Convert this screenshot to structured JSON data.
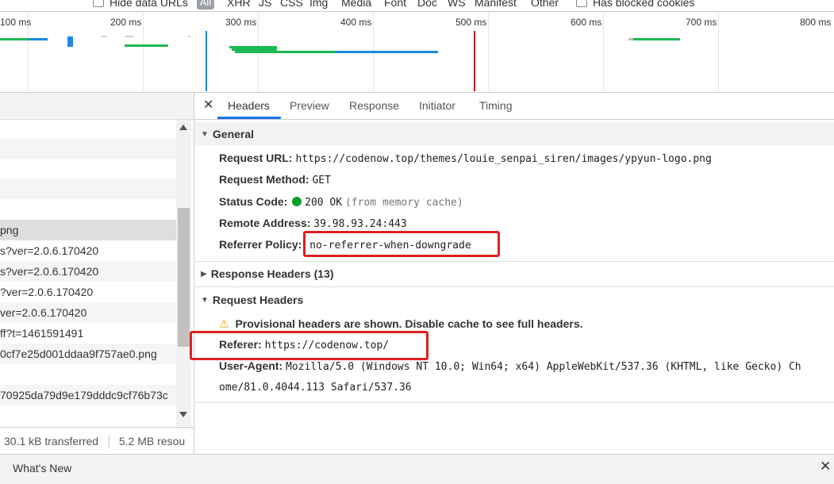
{
  "filters": {
    "hide_data_urls": "Hide data URLs",
    "all": "All",
    "types": [
      "XHR",
      "JS",
      "CSS",
      "Img",
      "Media",
      "Font",
      "Doc",
      "WS",
      "Manifest",
      "Other"
    ],
    "has_blocked_cookies": "Has blocked cookies"
  },
  "timeline": {
    "ticks": [
      "100 ms",
      "200 ms",
      "300 ms",
      "400 ms",
      "500 ms",
      "600 ms",
      "700 ms",
      "800 ms"
    ]
  },
  "requests": [
    "",
    "",
    "",
    "",
    "",
    "png",
    "s?ver=2.0.6.170420",
    "s?ver=2.0.6.170420",
    "?ver=2.0.6.170420",
    "ver=2.0.6.170420",
    "ff?t=1461591491",
    "0cf7e25d001ddaa9f757ae0.png",
    "",
    "70925da79d9e179dddc9cf76b73c"
  ],
  "status": {
    "transferred": "30.1 kB transferred",
    "resources": "5.2 MB resou"
  },
  "tabs": [
    "Headers",
    "Preview",
    "Response",
    "Initiator",
    "Timing"
  ],
  "general": {
    "title": "General",
    "request_url_label": "Request URL:",
    "request_url": "https://codenow.top/themes/louie_senpai_siren/images/ypyun-logo.png",
    "request_method_label": "Request Method:",
    "request_method": "GET",
    "status_code_label": "Status Code:",
    "status_code": "200 OK",
    "status_note": "(from memory cache)",
    "status_color": "#0a9e2a",
    "remote_address_label": "Remote Address:",
    "remote_address": "39.98.93.24:443",
    "referrer_policy_label": "Referrer Policy:",
    "referrer_policy": "no-referrer-when-downgrade"
  },
  "response_headers": {
    "title": "Response Headers (13)"
  },
  "request_headers": {
    "title": "Request Headers",
    "warning": "Provisional headers are shown. Disable cache to see full headers.",
    "referer_label": "Referer:",
    "referer": "https://codenow.top/",
    "user_agent_label": "User-Agent:",
    "user_agent_line1": "Mozilla/5.0 (Windows NT 10.0; Win64; x64) AppleWebKit/537.36 (KHTML, like Gecko) Ch",
    "user_agent_line2": "ome/81.0.4044.113 Safari/537.36"
  },
  "drawer": {
    "whats_new": "What's New"
  },
  "colors": {
    "highlight": "#e02020",
    "accent": "#1a73e8",
    "waterfall_green": "#1db954",
    "waterfall_blue": "#1e88e5"
  }
}
